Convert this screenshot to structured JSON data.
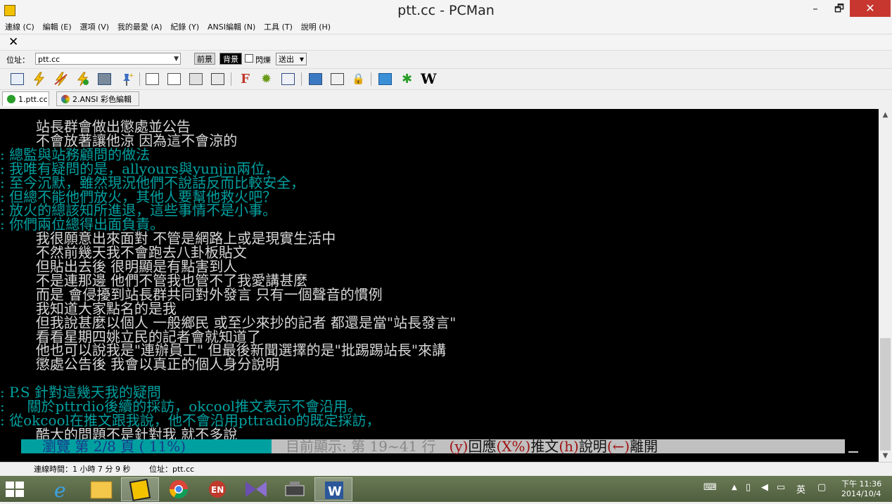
{
  "window": {
    "title": "ptt.cc - PCMan",
    "min": "–",
    "max": "🗗",
    "close": "✕"
  },
  "menu": [
    "連線 (C)",
    "編輯 (E)",
    "選項 (V)",
    "我的最愛 (A)",
    "紀錄 (Y)",
    "ANSI編輯 (N)",
    "工具 (T)",
    "說明 (H)"
  ],
  "closebar": {
    "close": "✕"
  },
  "address": {
    "label": "位址：",
    "value": "ptt.cc",
    "fg_label": "前景",
    "bg_label": "背景",
    "blink_label": "閃爍",
    "send_label": "送出"
  },
  "toolbar_icons": [
    "address-book-icon",
    "connect-icon",
    "reconnect-icon",
    "disconnect-icon",
    "photo-icon",
    "pin-icon",
    "copy-icon",
    "paste-icon",
    "copy-paste-icon",
    "save-screen-icon",
    "font-icon",
    "settings-icon",
    "resize-icon",
    "monitor-icon",
    "calculator-icon",
    "lock-icon",
    "search-icon",
    "flower-icon",
    "wikipedia-icon"
  ],
  "toolbar_glyphs": {
    "font": "F",
    "wiki": "W"
  },
  "tabs": [
    {
      "label": "1.ptt.cc",
      "color": "#2a9d2a"
    },
    {
      "label": "2.ANSI 彩色編輯",
      "color": "#c0392b"
    }
  ],
  "terminal_lines": [
    {
      "text": "        站長群會做出懲處並公告",
      "color": "w"
    },
    {
      "text": "        不會放著讓他涼 因為這不會涼的",
      "color": "w"
    },
    {
      "text": ": 總監與站務顧問的做法",
      "color": "c"
    },
    {
      "text": ": 我唯有疑問的是，allyours與yunjin兩位，",
      "color": "c"
    },
    {
      "text": ": 至今沉默，雖然現況他們不說話反而比較安全，",
      "color": "c"
    },
    {
      "text": ": 但總不能他們放火，其他人要幫他救火吧？",
      "color": "c"
    },
    {
      "text": ": 放火的總該知所進退，這些事情不是小事。",
      "color": "c"
    },
    {
      "text": ": 你們兩位總得出面負責。",
      "color": "c"
    },
    {
      "text": "        我很願意出來面對 不管是網路上或是現實生活中",
      "color": "w"
    },
    {
      "text": "        不然前幾天我不會跑去八卦板貼文",
      "color": "w"
    },
    {
      "text": "        但貼出去後 很明顯是有點害到人",
      "color": "w"
    },
    {
      "text": "        不是連那邊 他們不管我也管不了我愛講甚麼",
      "color": "w"
    },
    {
      "text": "        而是 會侵擾到站長群共同對外發言 只有一個聲音的慣例",
      "color": "w"
    },
    {
      "text": "        我知道大家點名的是我",
      "color": "w"
    },
    {
      "text": "        但我說甚麼以個人 一般鄉民 或至少來抄的記者 都還是當\"站長發言\"",
      "color": "w"
    },
    {
      "text": "        看看星期四姚立民的記者會就知道了",
      "color": "w"
    },
    {
      "text": "        他也可以說我是\"連辦員工\" 但最後新聞選擇的是\"批踢踢站長\"來講",
      "color": "w"
    },
    {
      "text": "        懲處公告後 我會以真正的個人身分說明",
      "color": "w"
    },
    {
      "text": "",
      "color": "w"
    },
    {
      "text": ": P.S 針對這幾天我的疑問",
      "color": "c"
    },
    {
      "text": ":     關於pttrdio後續的採訪，okcool推文表示不會沿用。",
      "color": "c"
    },
    {
      "text": ": 從okcool在推文跟我說，他不會沿用pttradio的既定採訪，",
      "color": "c"
    },
    {
      "text": "        酷大的問題不是針對我 就不多說",
      "color": "w"
    }
  ],
  "status_line": {
    "left": "瀏覽 第 2/8 頁 ( 11%)",
    "mid": "目前顯示: 第 19~41 行",
    "y_key": "(y)",
    "y_label": "回應",
    "x_key": "(X%)",
    "x_label": "推文",
    "h_key": "(h)",
    "h_label": "說明",
    "l_key": "(←)",
    "l_label": "離開"
  },
  "scrollbar": {
    "up": "▲",
    "down": "▼",
    "position_fraction": 0.69
  },
  "statusbar": {
    "conn_time": "連線時間：1 小時 7 分 9 秒",
    "addr": "位址：ptt.cc"
  },
  "taskbar": {
    "apps": [
      "internet-explorer-icon",
      "file-explorer-icon",
      "pcman-icon",
      "chrome-icon",
      "en-icon",
      "media-icon",
      "scanner-icon",
      "word-icon"
    ],
    "ime": "英",
    "time": "下午 11:36",
    "date": "2014/10/4"
  }
}
